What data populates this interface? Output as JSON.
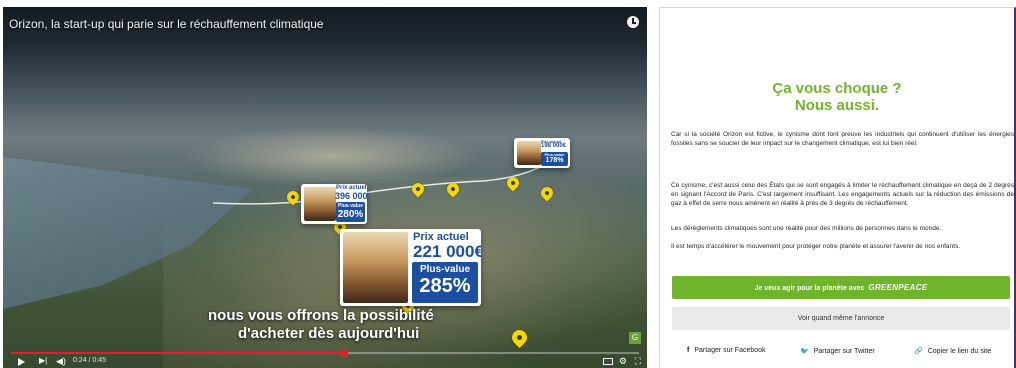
{
  "video": {
    "title": "Orizon, la start-up qui parie sur le réchauffement climatique",
    "subtitle_line1": "nous vous offrons la possibilité",
    "subtitle_line2": "d'acheter dès aujourd'hui",
    "time": "0:24 / 0:45",
    "progress_fraction": 0.53,
    "cards": {
      "main": {
        "label": "Prix actuel",
        "price": "221 000€",
        "plus_label": "Plus-value",
        "plus_value": "285%"
      },
      "mid": {
        "label": "Prix actuel",
        "price": "396 000€",
        "plus_label": "Plus-value",
        "plus_value": "280%"
      },
      "small": {
        "label": "Prix actuel",
        "price": "198 000€",
        "plus_label": "Plus-value",
        "plus_value": "178%"
      }
    },
    "accent_color": "#e0202a"
  },
  "panel": {
    "title_line1": "Ça vous choque ?",
    "title_line2": "Nous aussi.",
    "paragraph1": "Car si la société Orizon est fictive, le cynisme dont font preuve les industriels qui continuent d'utiliser les énergies fossiles sans se soucier de leur impact sur le changement climatique, est lui bien réel.",
    "paragraph2": "Ce cynisme, c'est aussi celui des États qui se sont engagés à limiter le réchauffement climatique en deçà de 2 degrés en signant l'Accord de Paris. C'est largement insuffisant. Les engagements actuels sur la réduction des émissions de gaz à effet de serre nous amènent en réalité à près de 3 degrés de réchauffement.",
    "paragraph3": "Les dérèglements climatiques sont une réalité pour des millions de personnes dans le monde.",
    "paragraph4": "Il est temps d'accélérer le mouvement pour protéger notre planète et assurer l'avenir de nos enfants.",
    "act_button": "Je veux agir pour la planète avec",
    "act_button_brand": "GREENPEACE",
    "ad_button": "Voir quand même l'annonce",
    "share_facebook": "Partager sur Facebook",
    "share_twitter": "Partager sur Twitter",
    "copy_link": "Copier le lien du site",
    "brand_color": "#73b42d"
  }
}
